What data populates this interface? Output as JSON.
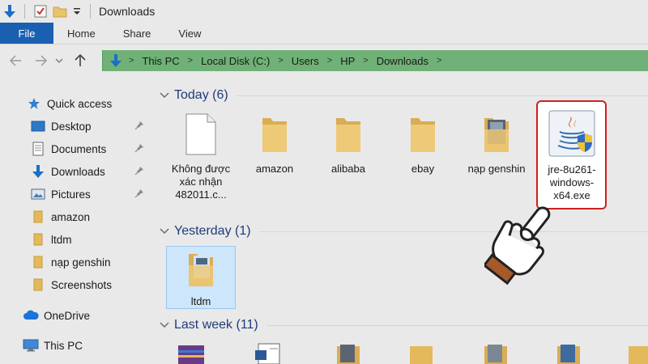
{
  "window": {
    "title": "Downloads"
  },
  "ribbon": {
    "tabs": [
      "File",
      "Home",
      "Share",
      "View"
    ]
  },
  "address": {
    "crumbs": [
      "This PC",
      "Local Disk (C:)",
      "Users",
      "HP",
      "Downloads"
    ]
  },
  "sidebar": {
    "quick_access": "Quick access",
    "items": [
      "Desktop",
      "Documents",
      "Downloads",
      "Pictures",
      "amazon",
      "ltdm",
      "nạp genshin",
      "Screenshots"
    ],
    "onedrive": "OneDrive",
    "thispc": "This PC"
  },
  "groups": {
    "today": "Today (6)",
    "yesterday": "Yesterday (1)",
    "lastweek": "Last week (11)"
  },
  "files_today": [
    {
      "name": "Không được xác nhận 482011.c...",
      "icon": "document-icon"
    },
    {
      "name": "amazon",
      "icon": "folder-icon"
    },
    {
      "name": "alibaba",
      "icon": "folder-icon"
    },
    {
      "name": "ebay",
      "icon": "folder-icon"
    },
    {
      "name": "nạp genshin",
      "icon": "folder-preview-icon"
    },
    {
      "name": "jre-8u261-windows-x64.exe",
      "icon": "java-installer-icon"
    }
  ],
  "files_yesterday": [
    {
      "name": "ltdm",
      "icon": "folder-preview-icon"
    }
  ],
  "colors": {
    "file_tab": "#1a5fb0",
    "address_highlight": "#6fb176",
    "callout": "#d0201f",
    "group_header": "#1f3b7a"
  }
}
